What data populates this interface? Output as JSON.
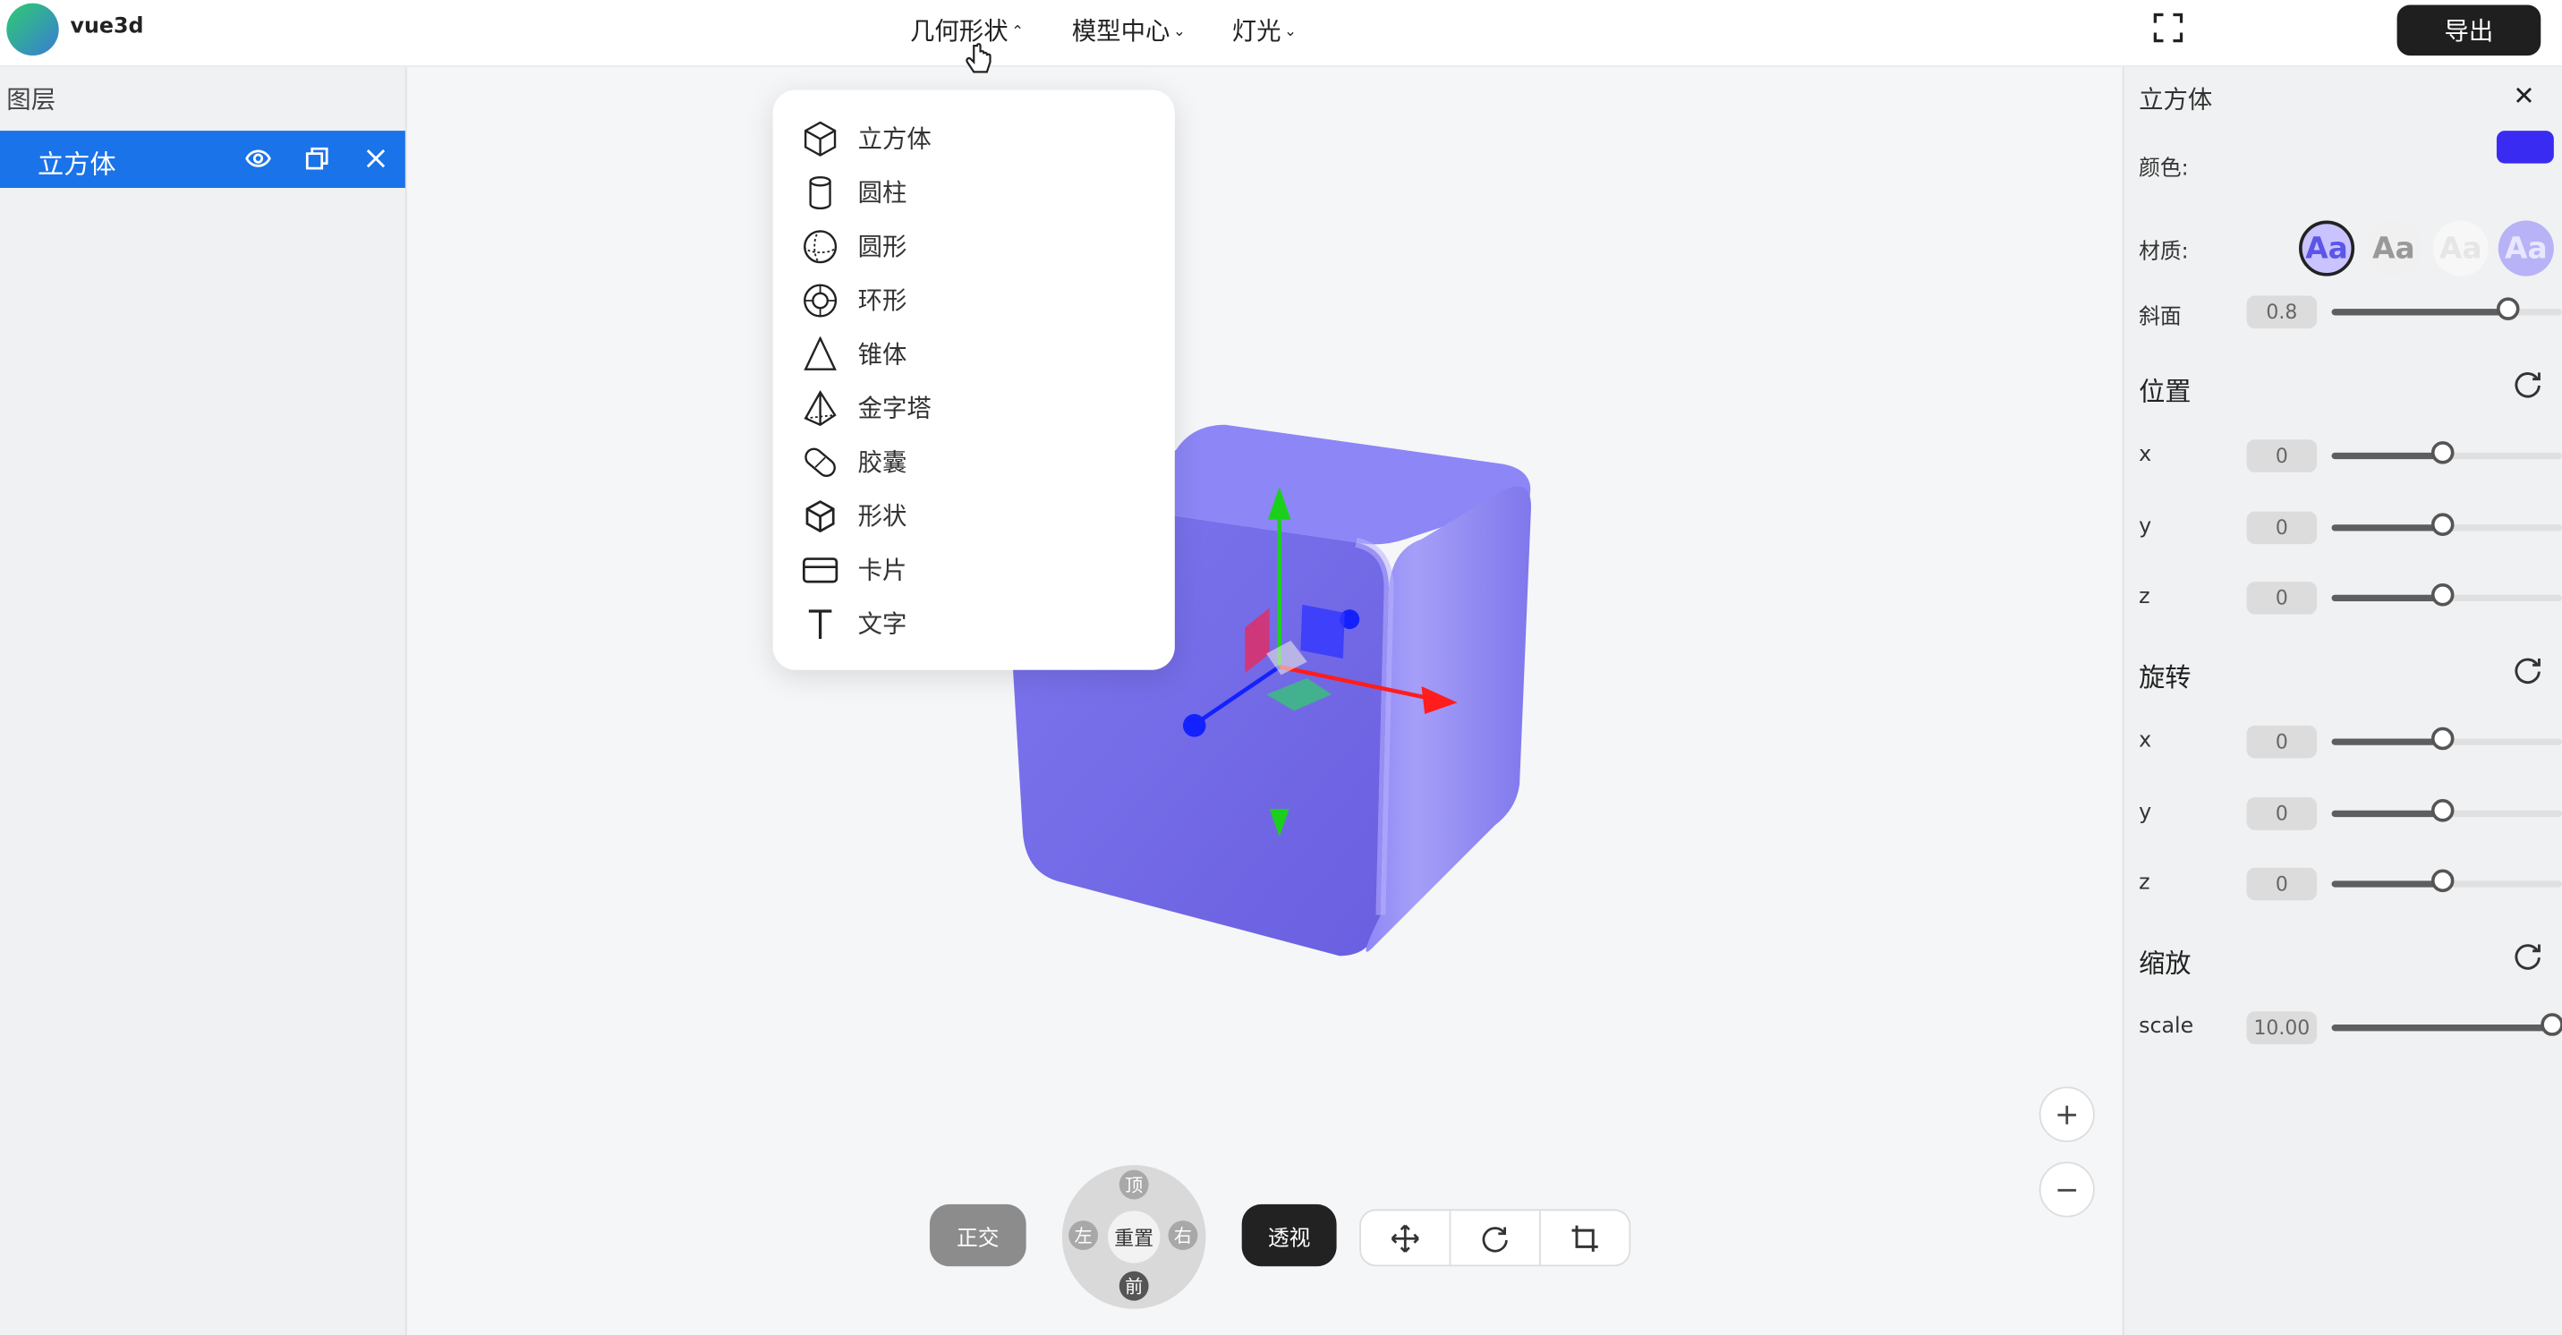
{
  "app": {
    "name": "vue3d"
  },
  "menu": {
    "geometry": "几何形状",
    "models": "模型中心",
    "lights": "灯光"
  },
  "toolbar": {
    "export_label": "导出"
  },
  "layers": {
    "title": "图层",
    "items": [
      {
        "label": "立方体"
      }
    ]
  },
  "dropdown": {
    "items": [
      {
        "label": "立方体",
        "icon": "cube-icon"
      },
      {
        "label": "圆柱",
        "icon": "cylinder-icon"
      },
      {
        "label": "圆形",
        "icon": "sphere-icon"
      },
      {
        "label": "环形",
        "icon": "torus-icon"
      },
      {
        "label": "锥体",
        "icon": "cone-icon"
      },
      {
        "label": "金字塔",
        "icon": "pyramid-icon"
      },
      {
        "label": "胶囊",
        "icon": "capsule-icon"
      },
      {
        "label": "形状",
        "icon": "shape-icon"
      },
      {
        "label": "卡片",
        "icon": "card-icon"
      },
      {
        "label": "文字",
        "icon": "text-icon"
      }
    ]
  },
  "viewport": {
    "ortho_label": "正交",
    "persp_label": "透视",
    "dial": {
      "top": "顶",
      "bottom": "前",
      "left": "左",
      "right": "右",
      "center": "重置"
    },
    "zoom_in": "+",
    "zoom_out": "−"
  },
  "props": {
    "title": "立方体",
    "color_label": "颜色:",
    "color": "#3a2bf2",
    "material_label": "材质:",
    "bevel_label": "斜面",
    "bevel_value": "0.8",
    "bevel_level": 0.8,
    "position": {
      "title": "位置",
      "rows": [
        {
          "axis": "x",
          "value": "0",
          "level": 0.5
        },
        {
          "axis": "y",
          "value": "0",
          "level": 0.5
        },
        {
          "axis": "z",
          "value": "0",
          "level": 0.5
        }
      ]
    },
    "rotation": {
      "title": "旋转",
      "rows": [
        {
          "axis": "x",
          "value": "0",
          "level": 0.5
        },
        {
          "axis": "y",
          "value": "0",
          "level": 0.5
        },
        {
          "axis": "z",
          "value": "0",
          "level": 0.5
        }
      ]
    },
    "scale": {
      "title": "缩放",
      "label": "scale",
      "value": "10.00",
      "level": 1.0
    }
  }
}
